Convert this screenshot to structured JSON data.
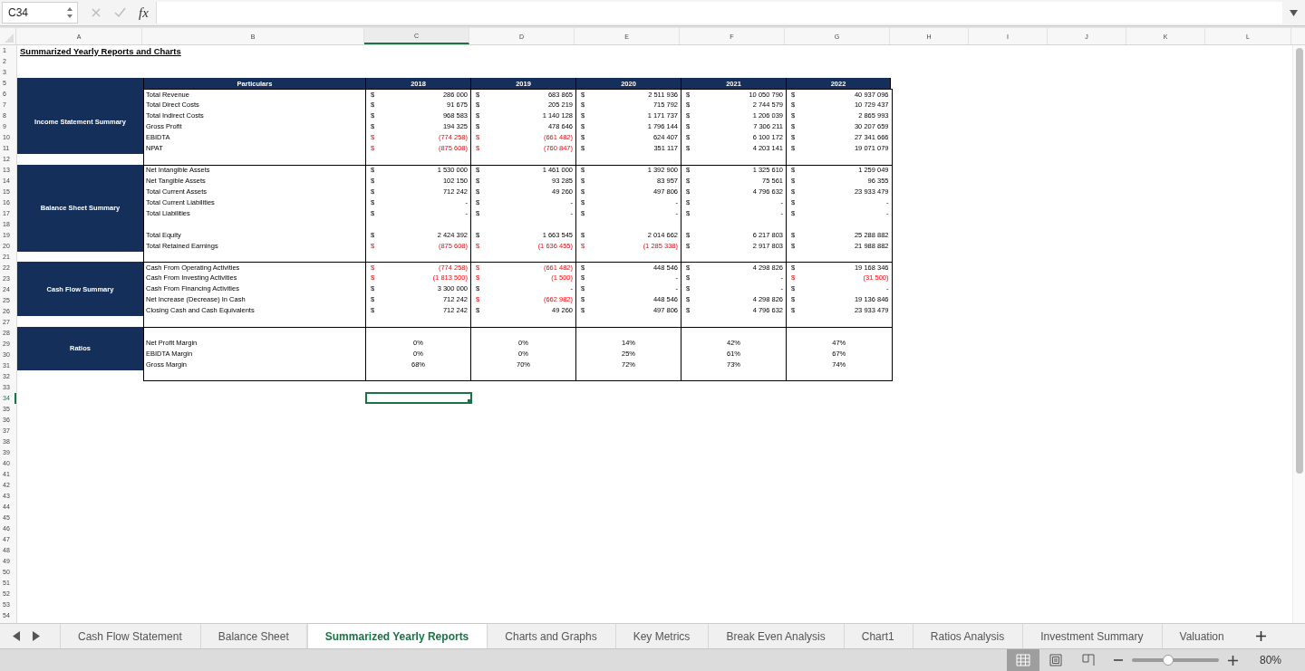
{
  "formula_bar": {
    "cell_reference": "C34",
    "function_label": "fx"
  },
  "columns": [
    {
      "label": "A",
      "selected": false
    },
    {
      "label": "B",
      "selected": false
    },
    {
      "label": "C",
      "selected": true
    },
    {
      "label": "D",
      "selected": false
    },
    {
      "label": "E",
      "selected": false
    },
    {
      "label": "F",
      "selected": false
    },
    {
      "label": "G",
      "selected": false
    },
    {
      "label": "H",
      "selected": false
    },
    {
      "label": "I",
      "selected": false
    },
    {
      "label": "J",
      "selected": false
    },
    {
      "label": "K",
      "selected": false
    },
    {
      "label": "L",
      "selected": false
    }
  ],
  "row_headers": [
    {
      "label": "1",
      "selected": false
    },
    {
      "label": "2",
      "selected": false
    },
    {
      "label": "3",
      "selected": false
    },
    {
      "label": "5",
      "selected": false
    },
    {
      "label": "6",
      "selected": false
    },
    {
      "label": "7",
      "selected": false
    },
    {
      "label": "8",
      "selected": false
    },
    {
      "label": "9",
      "selected": false
    },
    {
      "label": "10",
      "selected": false
    },
    {
      "label": "11",
      "selected": false
    },
    {
      "label": "12",
      "selected": false
    },
    {
      "label": "13",
      "selected": false
    },
    {
      "label": "14",
      "selected": false
    },
    {
      "label": "15",
      "selected": false
    },
    {
      "label": "16",
      "selected": false
    },
    {
      "label": "17",
      "selected": false
    },
    {
      "label": "18",
      "selected": false
    },
    {
      "label": "19",
      "selected": false
    },
    {
      "label": "20",
      "selected": false
    },
    {
      "label": "21",
      "selected": false
    },
    {
      "label": "22",
      "selected": false
    },
    {
      "label": "23",
      "selected": false
    },
    {
      "label": "24",
      "selected": false
    },
    {
      "label": "25",
      "selected": false
    },
    {
      "label": "26",
      "selected": false
    },
    {
      "label": "27",
      "selected": false
    },
    {
      "label": "28",
      "selected": false
    },
    {
      "label": "29",
      "selected": false
    },
    {
      "label": "30",
      "selected": false
    },
    {
      "label": "31",
      "selected": false
    },
    {
      "label": "32",
      "selected": false
    },
    {
      "label": "33",
      "selected": false
    },
    {
      "label": "34",
      "selected": true
    },
    {
      "label": "35",
      "selected": false
    },
    {
      "label": "36",
      "selected": false
    },
    {
      "label": "37",
      "selected": false
    },
    {
      "label": "38",
      "selected": false
    },
    {
      "label": "39",
      "selected": false
    },
    {
      "label": "40",
      "selected": false
    },
    {
      "label": "41",
      "selected": false
    },
    {
      "label": "42",
      "selected": false
    },
    {
      "label": "43",
      "selected": false
    },
    {
      "label": "44",
      "selected": false
    },
    {
      "label": "45",
      "selected": false
    },
    {
      "label": "46",
      "selected": false
    },
    {
      "label": "47",
      "selected": false
    },
    {
      "label": "48",
      "selected": false
    },
    {
      "label": "49",
      "selected": false
    },
    {
      "label": "50",
      "selected": false
    },
    {
      "label": "51",
      "selected": false
    },
    {
      "label": "52",
      "selected": false
    },
    {
      "label": "53",
      "selected": false
    },
    {
      "label": "54",
      "selected": false
    }
  ],
  "sheet_title": "Summarized Yearly Reports and Charts",
  "report": {
    "particulars_header": "Particulars",
    "years": [
      "2018",
      "2019",
      "2020",
      "2021",
      "2022"
    ],
    "sections": [
      {
        "title": "Income Statement Summary",
        "rows": [
          {
            "kind": "money",
            "label": "Total Revenue",
            "values": [
              {
                "cur": "$",
                "amt": "286 000",
                "neg": false
              },
              {
                "cur": "$",
                "amt": "683 865",
                "neg": false
              },
              {
                "cur": "$",
                "amt": "2 511 936",
                "neg": false
              },
              {
                "cur": "$",
                "amt": "10 050 790",
                "neg": false
              },
              {
                "cur": "$",
                "amt": "40 937 096",
                "neg": false
              }
            ]
          },
          {
            "kind": "money",
            "label": "Total Direct Costs",
            "values": [
              {
                "cur": "$",
                "amt": "91 675",
                "neg": false
              },
              {
                "cur": "$",
                "amt": "205 219",
                "neg": false
              },
              {
                "cur": "$",
                "amt": "715 792",
                "neg": false
              },
              {
                "cur": "$",
                "amt": "2 744 579",
                "neg": false
              },
              {
                "cur": "$",
                "amt": "10 729 437",
                "neg": false
              }
            ]
          },
          {
            "kind": "money",
            "label": "Total Indirect Costs",
            "values": [
              {
                "cur": "$",
                "amt": "968 583",
                "neg": false
              },
              {
                "cur": "$",
                "amt": "1 140 128",
                "neg": false
              },
              {
                "cur": "$",
                "amt": "1 171 737",
                "neg": false
              },
              {
                "cur": "$",
                "amt": "1 206 039",
                "neg": false
              },
              {
                "cur": "$",
                "amt": "2 865 993",
                "neg": false
              }
            ]
          },
          {
            "kind": "money",
            "label": "Gross Profit",
            "values": [
              {
                "cur": "$",
                "amt": "194 325",
                "neg": false
              },
              {
                "cur": "$",
                "amt": "478 646",
                "neg": false
              },
              {
                "cur": "$",
                "amt": "1 796 144",
                "neg": false
              },
              {
                "cur": "$",
                "amt": "7 306 211",
                "neg": false
              },
              {
                "cur": "$",
                "amt": "30 207 659",
                "neg": false
              }
            ]
          },
          {
            "kind": "money",
            "label": "EBIDTA",
            "values": [
              {
                "cur": "$",
                "amt": "(774 258)",
                "neg": true
              },
              {
                "cur": "$",
                "amt": "(661 482)",
                "neg": true
              },
              {
                "cur": "$",
                "amt": "624 407",
                "neg": false
              },
              {
                "cur": "$",
                "amt": "6 100 172",
                "neg": false
              },
              {
                "cur": "$",
                "amt": "27 341 666",
                "neg": false
              }
            ]
          },
          {
            "kind": "money",
            "label": "NPAT",
            "values": [
              {
                "cur": "$",
                "amt": "(875 608)",
                "neg": true
              },
              {
                "cur": "$",
                "amt": "(760 847)",
                "neg": true
              },
              {
                "cur": "$",
                "amt": "351 117",
                "neg": false
              },
              {
                "cur": "$",
                "amt": "4 203 141",
                "neg": false
              },
              {
                "cur": "$",
                "amt": "19 071 079",
                "neg": false
              }
            ]
          }
        ]
      },
      {
        "title": "Balance Sheet Summary",
        "rows": [
          {
            "kind": "money",
            "label": "Net Intangible Assets",
            "values": [
              {
                "cur": "$",
                "amt": "1 530 000",
                "neg": false
              },
              {
                "cur": "$",
                "amt": "1 461 000",
                "neg": false
              },
              {
                "cur": "$",
                "amt": "1 392 900",
                "neg": false
              },
              {
                "cur": "$",
                "amt": "1 325 610",
                "neg": false
              },
              {
                "cur": "$",
                "amt": "1 259 049",
                "neg": false
              }
            ]
          },
          {
            "kind": "money",
            "label": "Net Tangible Assets",
            "values": [
              {
                "cur": "$",
                "amt": "102 150",
                "neg": false
              },
              {
                "cur": "$",
                "amt": "93 285",
                "neg": false
              },
              {
                "cur": "$",
                "amt": "83 957",
                "neg": false
              },
              {
                "cur": "$",
                "amt": "75 561",
                "neg": false
              },
              {
                "cur": "$",
                "amt": "96 355",
                "neg": false
              }
            ]
          },
          {
            "kind": "money",
            "label": "Total Current Assets",
            "values": [
              {
                "cur": "$",
                "amt": "712 242",
                "neg": false
              },
              {
                "cur": "$",
                "amt": "49 260",
                "neg": false
              },
              {
                "cur": "$",
                "amt": "497 806",
                "neg": false
              },
              {
                "cur": "$",
                "amt": "4 796 632",
                "neg": false
              },
              {
                "cur": "$",
                "amt": "23 933 479",
                "neg": false
              }
            ]
          },
          {
            "kind": "money",
            "label": "Total Current Liabilities",
            "values": [
              {
                "cur": "$",
                "amt": "-",
                "neg": false
              },
              {
                "cur": "$",
                "amt": "-",
                "neg": false
              },
              {
                "cur": "$",
                "amt": "-",
                "neg": false
              },
              {
                "cur": "$",
                "amt": "-",
                "neg": false
              },
              {
                "cur": "$",
                "amt": "-",
                "neg": false
              }
            ]
          },
          {
            "kind": "money",
            "label": "Total Liabilities",
            "values": [
              {
                "cur": "$",
                "amt": "-",
                "neg": false
              },
              {
                "cur": "$",
                "amt": "-",
                "neg": false
              },
              {
                "cur": "$",
                "amt": "-",
                "neg": false
              },
              {
                "cur": "$",
                "amt": "-",
                "neg": false
              },
              {
                "cur": "$",
                "amt": "-",
                "neg": false
              }
            ]
          },
          {
            "kind": "spacer"
          },
          {
            "kind": "money",
            "label": "Total Equity",
            "values": [
              {
                "cur": "$",
                "amt": "2 424 392",
                "neg": false
              },
              {
                "cur": "$",
                "amt": "1 663 545",
                "neg": false
              },
              {
                "cur": "$",
                "amt": "2 014 662",
                "neg": false
              },
              {
                "cur": "$",
                "amt": "6 217 803",
                "neg": false
              },
              {
                "cur": "$",
                "amt": "25 288 882",
                "neg": false
              }
            ]
          },
          {
            "kind": "money",
            "label": "Total Retained Earnings",
            "values": [
              {
                "cur": "$",
                "amt": "(875 608)",
                "neg": true
              },
              {
                "cur": "$",
                "amt": "(1 636 455)",
                "neg": true
              },
              {
                "cur": "$",
                "amt": "(1 285 338)",
                "neg": true
              },
              {
                "cur": "$",
                "amt": "2 917 803",
                "neg": false
              },
              {
                "cur": "$",
                "amt": "21 988 882",
                "neg": false
              }
            ]
          }
        ]
      },
      {
        "title": "Cash Flow Summary",
        "rows": [
          {
            "kind": "money",
            "label": "Cash From Operating Activities",
            "values": [
              {
                "cur": "$",
                "amt": "(774 258)",
                "neg": true
              },
              {
                "cur": "$",
                "amt": "(661 482)",
                "neg": true
              },
              {
                "cur": "$",
                "amt": "448 546",
                "neg": false
              },
              {
                "cur": "$",
                "amt": "4 298 826",
                "neg": false
              },
              {
                "cur": "$",
                "amt": "19 168 346",
                "neg": false
              }
            ]
          },
          {
            "kind": "money",
            "label": "Cash From Investing Activities",
            "values": [
              {
                "cur": "$",
                "amt": "(1 813 500)",
                "neg": true
              },
              {
                "cur": "$",
                "amt": "(1 500)",
                "neg": true
              },
              {
                "cur": "$",
                "amt": "-",
                "neg": false
              },
              {
                "cur": "$",
                "amt": "-",
                "neg": false
              },
              {
                "cur": "$",
                "amt": "(31 500)",
                "neg": true
              }
            ]
          },
          {
            "kind": "money",
            "label": "Cash From Financing Activities",
            "values": [
              {
                "cur": "$",
                "amt": "3 300 000",
                "neg": false
              },
              {
                "cur": "$",
                "amt": "-",
                "neg": false
              },
              {
                "cur": "$",
                "amt": "-",
                "neg": false
              },
              {
                "cur": "$",
                "amt": "-",
                "neg": false
              },
              {
                "cur": "$",
                "amt": "-",
                "neg": false
              }
            ]
          },
          {
            "kind": "money",
            "label": "Net Increase (Decrease) In Cash",
            "values": [
              {
                "cur": "$",
                "amt": "712 242",
                "neg": false
              },
              {
                "cur": "$",
                "amt": "(662 982)",
                "neg": true
              },
              {
                "cur": "$",
                "amt": "448 546",
                "neg": false
              },
              {
                "cur": "$",
                "amt": "4 298 826",
                "neg": false
              },
              {
                "cur": "$",
                "amt": "19 136 846",
                "neg": false
              }
            ]
          },
          {
            "kind": "money",
            "label": "Closing Cash and Cash Equivalents",
            "values": [
              {
                "cur": "$",
                "amt": "712 242",
                "neg": false
              },
              {
                "cur": "$",
                "amt": "49 260",
                "neg": false
              },
              {
                "cur": "$",
                "amt": "497 806",
                "neg": false
              },
              {
                "cur": "$",
                "amt": "4 796 632",
                "neg": false
              },
              {
                "cur": "$",
                "amt": "23 933 479",
                "neg": false
              }
            ]
          }
        ]
      },
      {
        "title": "Ratios",
        "rows": [
          {
            "kind": "spacer"
          },
          {
            "kind": "ratio",
            "label": "Net Profit Margin",
            "values": [
              {
                "amt": "0%"
              },
              {
                "amt": "0%"
              },
              {
                "amt": "14%"
              },
              {
                "amt": "42%"
              },
              {
                "amt": "47%"
              }
            ]
          },
          {
            "kind": "ratio",
            "label": "EBIDTA Margin",
            "values": [
              {
                "amt": "0%"
              },
              {
                "amt": "0%"
              },
              {
                "amt": "25%"
              },
              {
                "amt": "61%"
              },
              {
                "amt": "67%"
              }
            ]
          },
          {
            "kind": "ratio",
            "label": "Gross Margin",
            "values": [
              {
                "amt": "68%"
              },
              {
                "amt": "70%"
              },
              {
                "amt": "72%"
              },
              {
                "amt": "73%"
              },
              {
                "amt": "74%"
              }
            ]
          }
        ]
      }
    ]
  },
  "sheet_tabs": [
    {
      "label": "Cash Flow Statement",
      "selected": false
    },
    {
      "label": "Balance Sheet",
      "selected": false
    },
    {
      "label": "Summarized Yearly Reports",
      "selected": true
    },
    {
      "label": "Charts and Graphs",
      "selected": false
    },
    {
      "label": "Key Metrics",
      "selected": false
    },
    {
      "label": "Break Even Analysis",
      "selected": false
    },
    {
      "label": "Chart1",
      "selected": false
    },
    {
      "label": "Ratios Analysis",
      "selected": false
    },
    {
      "label": "Investment Summary",
      "selected": false
    },
    {
      "label": "Valuation",
      "selected": false
    }
  ],
  "status_bar": {
    "views": [
      {
        "kind": "normal",
        "selected": true
      },
      {
        "kind": "page-layout",
        "selected": false
      },
      {
        "kind": "page-break",
        "selected": false
      }
    ],
    "zoom": {
      "level": 0.42,
      "reading": "80%"
    }
  }
}
